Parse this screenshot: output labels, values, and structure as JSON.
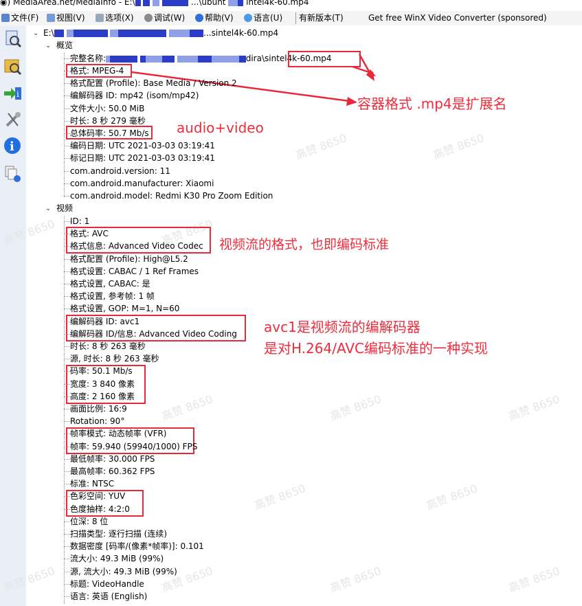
{
  "window": {
    "title_start": "MediaArea.net/MediaInfo - E:\\",
    "title_mid": "...\\ubunt",
    "title_end": "intel4k-60.mp4"
  },
  "menubar": {
    "items": [
      "文件(F)",
      "视图(V)",
      "选项(X)",
      "调试(W)",
      "帮助(V)",
      "语言(U)",
      "有新版本(T)",
      "Get free WinX Video Converter (sponsored)"
    ]
  },
  "tree": {
    "root_label": "sintel4k-60.mp4",
    "root_prefix": "E:\\",
    "general": {
      "header": "概览",
      "fullname_label": "完整名称:",
      "fullname_tail": "dira\\sintel4k-60.mp4",
      "rows": [
        "格式: MPEG-4",
        "格式配置 (Profile): Base Media / Version 2",
        "编解码器 ID: mp42 (isom/mp42)",
        "文件大小: 50.0 MiB",
        "时长: 8 秒 279 毫秒",
        "总体码率: 50.7 Mb/s",
        "编码日期: UTC 2021-03-03 03:19:41",
        "标记日期: UTC 2021-03-03 03:19:41",
        "com.android.version: 11",
        "com.android.manufacturer: Xiaomi",
        "com.android.model: Redmi K30 Pro Zoom Edition"
      ]
    },
    "video": {
      "header": "视频",
      "rows": [
        "ID: 1",
        "格式: AVC",
        "格式信息: Advanced Video Codec",
        "格式配置 (Profile): High@L5.2",
        "格式设置: CABAC / 1 Ref Frames",
        "格式设置, CABAC: 是",
        "格式设置, 参考帧: 1 帧",
        "格式设置, GOP: M=1, N=60",
        "编解码器 ID: avc1",
        "编解码器 ID/信息: Advanced Video Coding",
        "时长: 8 秒 263 毫秒",
        "源, 时长: 8 秒 263 毫秒",
        "码率: 50.1 Mb/s",
        "宽度: 3 840 像素",
        "高度: 2 160 像素",
        "画面比例: 16:9",
        "Rotation: 90°",
        "帧率模式: 动态帧率 (VFR)",
        "帧率: 59.940 (59940/1000) FPS",
        "最低帧率: 30.000 FPS",
        "最高帧率: 60.362 FPS",
        "标准: NTSC",
        "色彩空间: YUV",
        "色度抽样: 4:2:0",
        "位深: 8 位",
        "扫描类型: 逐行扫描 (连续)",
        "数据密度 [码率/(像素*帧率)]: 0.101",
        "流大小: 49.3 MiB (99%)",
        "源, 流大小: 49.3 MiB (99%)",
        "标题: VideoHandle",
        "语言: 英语 (English)"
      ]
    }
  },
  "annotations": {
    "container": "容器格式 .mp4是扩展名",
    "audio_video": "audio+video",
    "stream_format": "视频流的格式，也即编码标准",
    "avc1_line1": "avc1是视频流的编解码器",
    "avc1_line2": "是对H.264/AVC编码标准的一种实现"
  },
  "watermark": "高赞 8650",
  "colors": {
    "annotation_red": "#ee2c3c",
    "box_red": "#e8283b",
    "sidebar_bg": "#e9eef7"
  }
}
